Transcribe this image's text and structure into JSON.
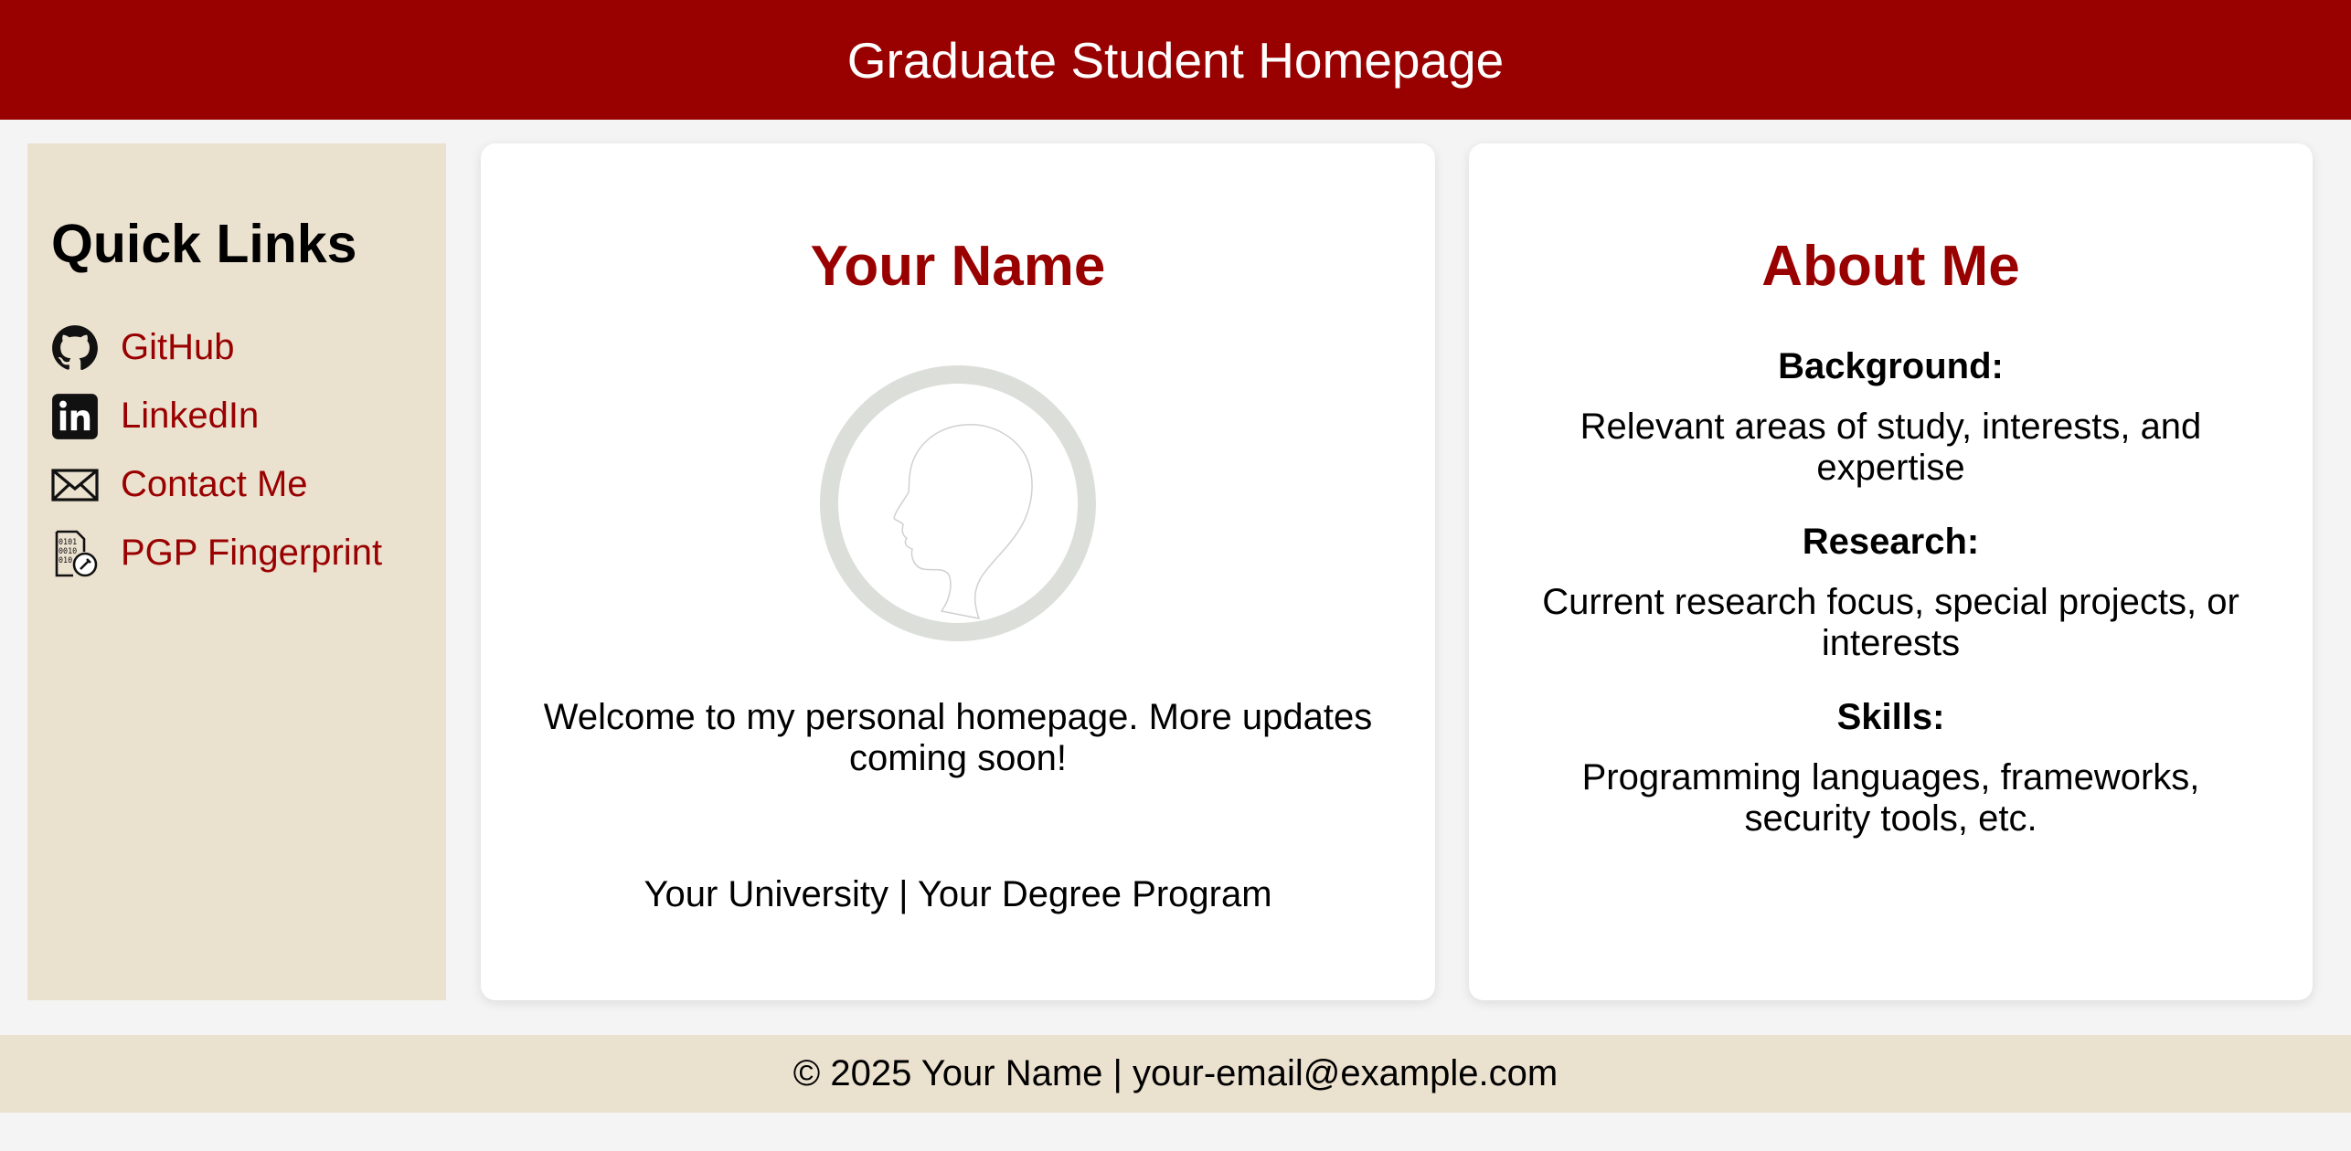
{
  "header": {
    "title": "Graduate Student Homepage"
  },
  "sidebar": {
    "heading": "Quick Links",
    "links": [
      {
        "label": "GitHub",
        "icon": "github-icon"
      },
      {
        "label": "LinkedIn",
        "icon": "linkedin-icon"
      },
      {
        "label": "Contact Me",
        "icon": "envelope-icon"
      },
      {
        "label": "PGP Fingerprint",
        "icon": "pgp-key-icon"
      }
    ]
  },
  "main": {
    "name": "Your Name",
    "avatar_icon": "profile-silhouette-icon",
    "welcome": "Welcome to my personal homepage. More updates coming soon!",
    "affiliation": "Your University | Your Degree Program"
  },
  "about": {
    "heading": "About Me",
    "sections": [
      {
        "title": "Background:",
        "text": "Relevant areas of study, interests, and expertise"
      },
      {
        "title": "Research:",
        "text": "Current research focus, special projects, or interests"
      },
      {
        "title": "Skills:",
        "text": "Programming languages, frameworks, security tools, etc."
      }
    ]
  },
  "footer": {
    "text": "© 2025 Your Name | your-email@example.com"
  },
  "colors": {
    "accent": "#990000",
    "sidebar_bg": "#ebe1cf",
    "page_bg": "#f4f4f4"
  }
}
